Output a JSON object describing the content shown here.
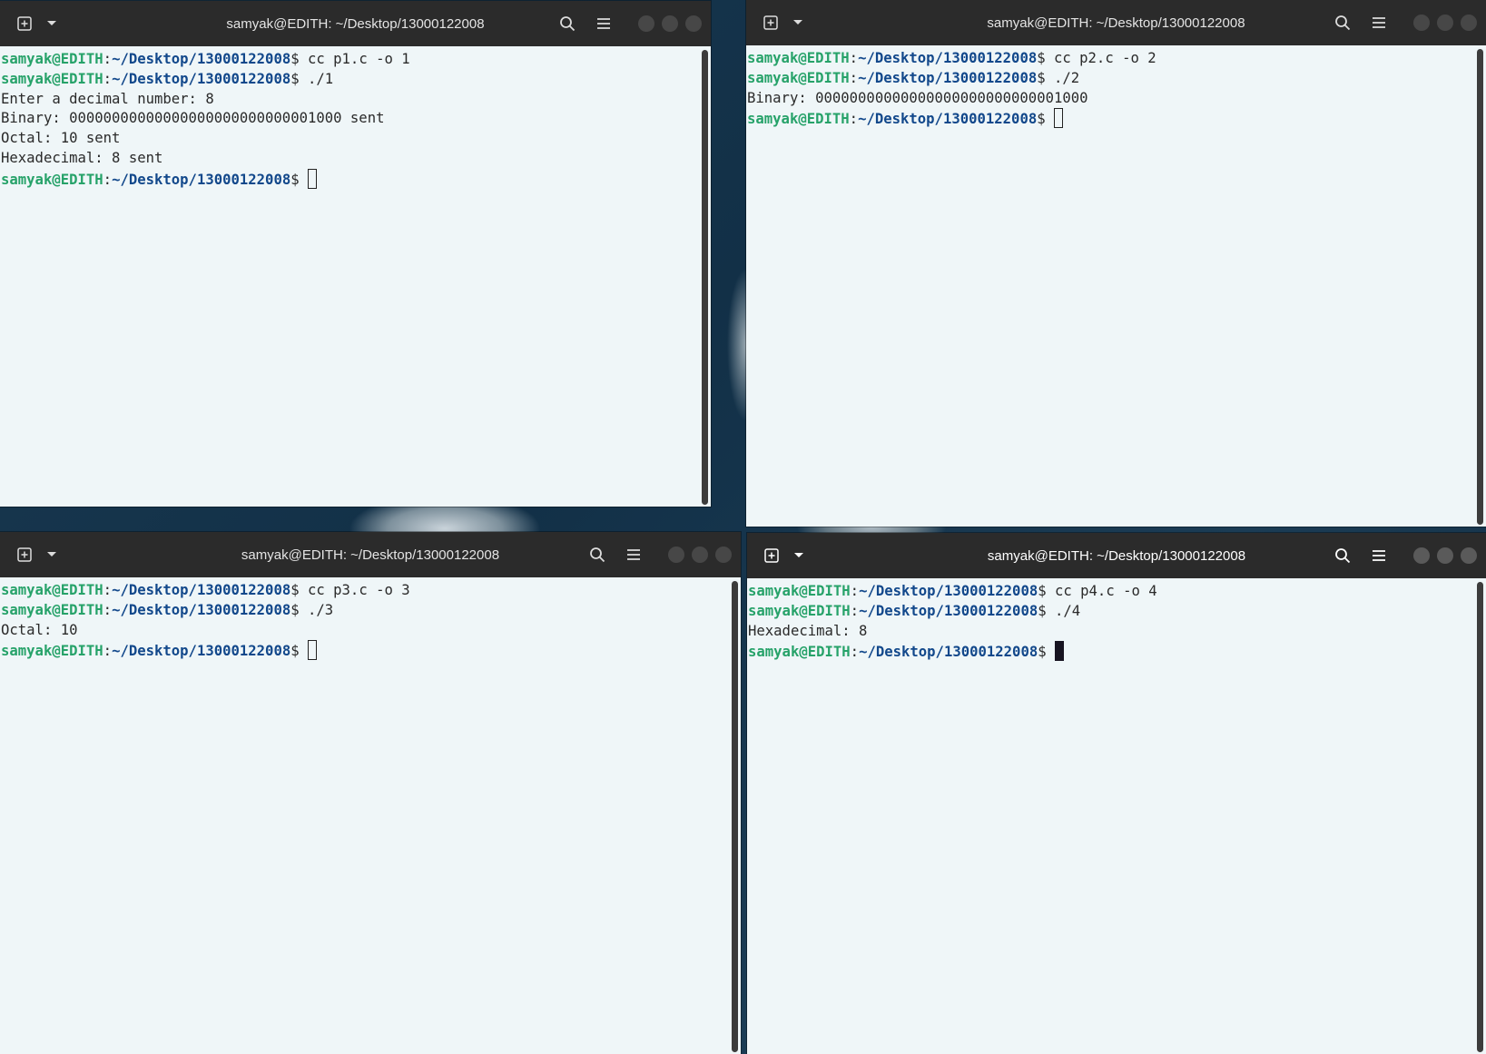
{
  "windows": [
    {
      "title": "samyak@EDITH: ~/Desktop/13000122008",
      "lines": [
        {
          "user": "samyak@EDITH",
          "sep": ":",
          "path": "~/Desktop/13000122008",
          "cmd": "$ cc p1.c -o 1"
        },
        {
          "user": "samyak@EDITH",
          "sep": ":",
          "path": "~/Desktop/13000122008",
          "cmd": "$ ./1"
        },
        {
          "text": "Enter a decimal number: 8"
        },
        {
          "text": "Binary: 00000000000000000000000000001000 sent"
        },
        {
          "text": "Octal: 10 sent"
        },
        {
          "text": "Hexadecimal: 8 sent"
        },
        {
          "user": "samyak@EDITH",
          "sep": ":",
          "path": "~/Desktop/13000122008",
          "cmd": "$ ",
          "cursor": "outline"
        }
      ]
    },
    {
      "title": "samyak@EDITH: ~/Desktop/13000122008",
      "lines": [
        {
          "user": "samyak@EDITH",
          "sep": ":",
          "path": "~/Desktop/13000122008",
          "cmd": "$ cc p2.c -o 2"
        },
        {
          "user": "samyak@EDITH",
          "sep": ":",
          "path": "~/Desktop/13000122008",
          "cmd": "$ ./2"
        },
        {
          "text": "Binary: 00000000000000000000000000001000"
        },
        {
          "user": "samyak@EDITH",
          "sep": ":",
          "path": "~/Desktop/13000122008",
          "cmd": "$ ",
          "cursor": "outline"
        }
      ]
    },
    {
      "title": "samyak@EDITH: ~/Desktop/13000122008",
      "lines": [
        {
          "user": "samyak@EDITH",
          "sep": ":",
          "path": "~/Desktop/13000122008",
          "cmd": "$ cc p3.c -o 3"
        },
        {
          "user": "samyak@EDITH",
          "sep": ":",
          "path": "~/Desktop/13000122008",
          "cmd": "$ ./3"
        },
        {
          "text": "Octal: 10"
        },
        {
          "user": "samyak@EDITH",
          "sep": ":",
          "path": "~/Desktop/13000122008",
          "cmd": "$ ",
          "cursor": "outline"
        }
      ]
    },
    {
      "title": "samyak@EDITH: ~/Desktop/13000122008",
      "lines": [
        {
          "user": "samyak@EDITH",
          "sep": ":",
          "path": "~/Desktop/13000122008",
          "cmd": "$ cc p4.c -o 4"
        },
        {
          "user": "samyak@EDITH",
          "sep": ":",
          "path": "~/Desktop/13000122008",
          "cmd": "$ ./4"
        },
        {
          "text": "Hexadecimal: 8"
        },
        {
          "user": "samyak@EDITH",
          "sep": ":",
          "path": "~/Desktop/13000122008",
          "cmd": "$ ",
          "cursor": "filled"
        }
      ]
    }
  ],
  "icons": {
    "new_tab": "new-tab-icon",
    "dropdown": "chevron-down-icon",
    "search": "search-icon",
    "menu": "hamburger-menu-icon"
  },
  "colors": {
    "prompt_user": "#26a269",
    "prompt_path": "#12488b",
    "terminal_bg": "#eff6f8",
    "titlebar_bg": "#2b2b2b"
  }
}
